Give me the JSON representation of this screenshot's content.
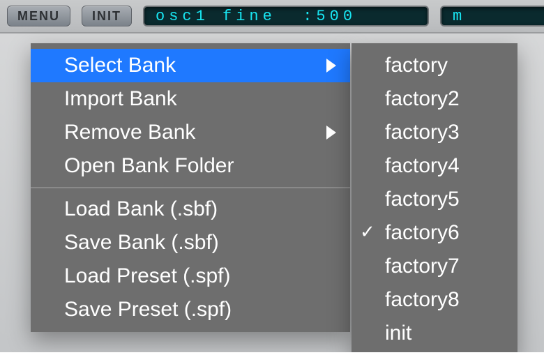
{
  "toolbar": {
    "menu_label": "MENU",
    "init_label": "INIT",
    "display_text": "osc1 fine  :500",
    "display_right_text": "m"
  },
  "menu": {
    "items": [
      {
        "label": "Select Bank",
        "has_submenu": true,
        "selected": true
      },
      {
        "label": "Import Bank",
        "has_submenu": false,
        "selected": false
      },
      {
        "label": "Remove Bank",
        "has_submenu": true,
        "selected": false
      },
      {
        "label": "Open Bank Folder",
        "has_submenu": false,
        "selected": false
      },
      {
        "separator": true
      },
      {
        "label": "Load Bank (.sbf)",
        "has_submenu": false,
        "selected": false
      },
      {
        "label": "Save Bank (.sbf)",
        "has_submenu": false,
        "selected": false
      },
      {
        "label": "Load Preset (.spf)",
        "has_submenu": false,
        "selected": false
      },
      {
        "label": "Save Preset (.spf)",
        "has_submenu": false,
        "selected": false
      }
    ]
  },
  "submenu": {
    "items": [
      {
        "label": "factory",
        "checked": false
      },
      {
        "label": "factory2",
        "checked": false
      },
      {
        "label": "factory3",
        "checked": false
      },
      {
        "label": "factory4",
        "checked": false
      },
      {
        "label": "factory5",
        "checked": false
      },
      {
        "label": "factory6",
        "checked": true
      },
      {
        "label": "factory7",
        "checked": false
      },
      {
        "label": "factory8",
        "checked": false
      },
      {
        "label": "init",
        "checked": false
      }
    ]
  }
}
